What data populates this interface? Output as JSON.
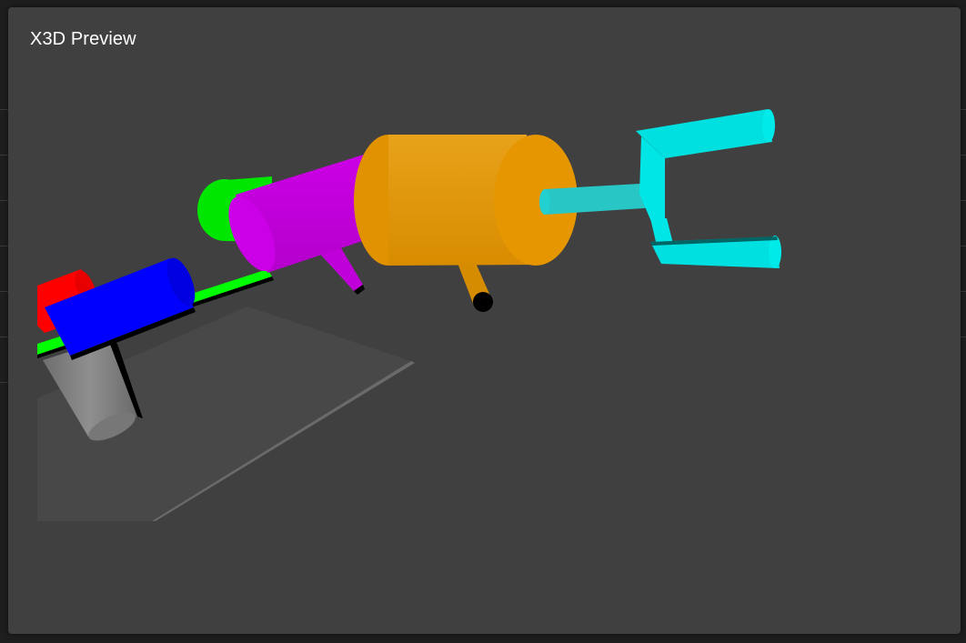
{
  "dialog": {
    "title": "X3D Preview"
  },
  "scene": {
    "object_colors": {
      "base": "#4a4a4a",
      "base_edge": "#5e5e5e",
      "pedestal": "#8a8a8a",
      "red_joint": "#ff0000",
      "blue_joint": "#0000ff",
      "green_link": "#00ff00",
      "magenta_joint": "#d000e8",
      "orange_joint": "#e39400",
      "cyan_gripper": "#00e5e5",
      "shadow": "#000000"
    }
  }
}
